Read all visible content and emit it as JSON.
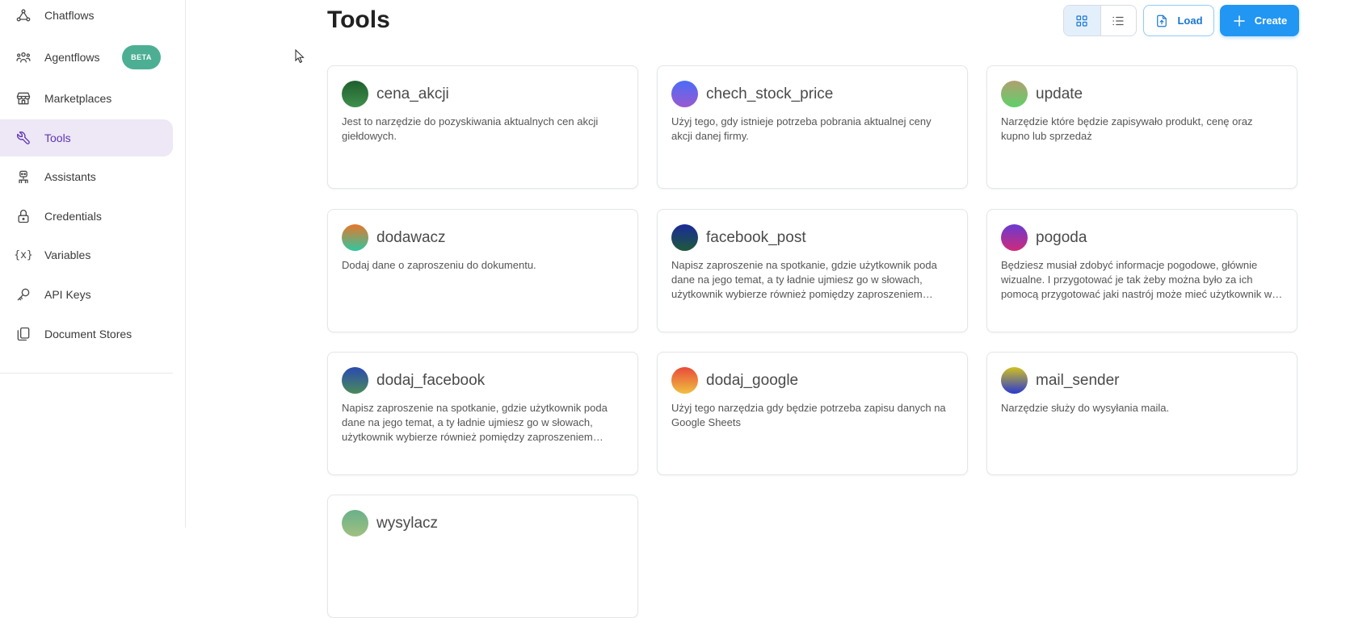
{
  "sidebar": {
    "items": [
      {
        "label": "Chatflows",
        "icon": "chatflows-icon",
        "active": false
      },
      {
        "label": "Agentflows",
        "icon": "agentflows-icon",
        "active": false,
        "badge": "BETA"
      },
      {
        "label": "Marketplaces",
        "icon": "marketplace-icon",
        "active": false
      },
      {
        "label": "Tools",
        "icon": "tools-icon",
        "active": true
      },
      {
        "label": "Assistants",
        "icon": "assistants-icon",
        "active": false
      },
      {
        "label": "Credentials",
        "icon": "lock-icon",
        "active": false
      },
      {
        "label": "Variables",
        "icon": "variables-icon",
        "active": false
      },
      {
        "label": "API Keys",
        "icon": "key-icon",
        "active": false
      },
      {
        "label": "Document Stores",
        "icon": "documents-icon",
        "active": false
      }
    ]
  },
  "header": {
    "title": "Tools",
    "view_modes": [
      "grid-view-icon",
      "list-view-icon"
    ],
    "active_view": "grid",
    "load_label": "Load",
    "create_label": "Create"
  },
  "colors": {
    "primary": "#2196f3",
    "active_bg": "#ede7f6",
    "active_text": "#5e35b1",
    "beta": "#4caf94"
  },
  "tools": [
    {
      "name": "cena_akcji",
      "description": "Jest to narzędzie do pozyskiwania aktualnych cen akcji giełdowych.",
      "gradient": [
        "#1e5f2e",
        "#3f8f4c"
      ]
    },
    {
      "name": "chech_stock_price",
      "description": "Użyj tego, gdy istnieje potrzeba pobrania aktualnej ceny akcji danej firmy.",
      "gradient": [
        "#4a6cf7",
        "#9b59d0"
      ]
    },
    {
      "name": "update",
      "description": "Narzędzie które będzie zapisywało produkt, cenę oraz kupno lub sprzedaż",
      "gradient": [
        "#b0a070",
        "#5fd06a"
      ]
    },
    {
      "name": "dodawacz",
      "description": "Dodaj dane o zaproszeniu do dokumentu.",
      "gradient": [
        "#e8762a",
        "#2fc7a0"
      ]
    },
    {
      "name": "facebook_post",
      "description": "Napisz zaproszenie na spotkanie, gdzie użytkownik poda dane na jego temat, a ty ładnie ujmiesz go w słowach, użytkownik wybierze również pomiędzy zaproszeniem formalnym a nieformalnym.",
      "gradient": [
        "#1a2a9a",
        "#1e5a3a"
      ]
    },
    {
      "name": "pogoda",
      "description": "Będziesz musiał zdobyć informacje pogodowe, głównie wizualne. I przygotować je tak żeby można było za ich pomocą przygotować jaki nastrój może mieć użytkownik w danym dniu.",
      "gradient": [
        "#6a3ad0",
        "#d02a7a"
      ]
    },
    {
      "name": "dodaj_facebook",
      "description": "Napisz zaproszenie na spotkanie, gdzie użytkownik poda dane na jego temat, a ty ładnie ujmiesz go w słowach, użytkownik wybierze również pomiędzy zaproszeniem formalnym a nieformalnym.",
      "gradient": [
        "#2a4ab0",
        "#4a8a5a"
      ]
    },
    {
      "name": "dodaj_google",
      "description": "Użyj tego narzędzia gdy będzie potrzeba zapisu danych na Google Sheets",
      "gradient": [
        "#e84a3a",
        "#f0c040"
      ]
    },
    {
      "name": "mail_sender",
      "description": "Narzędzie służy do wysyłania maila.",
      "gradient": [
        "#d0c020",
        "#2a3ad0"
      ]
    },
    {
      "name": "wysylacz",
      "description": "",
      "gradient": [
        "#6ab08a",
        "#a0c080"
      ]
    }
  ]
}
